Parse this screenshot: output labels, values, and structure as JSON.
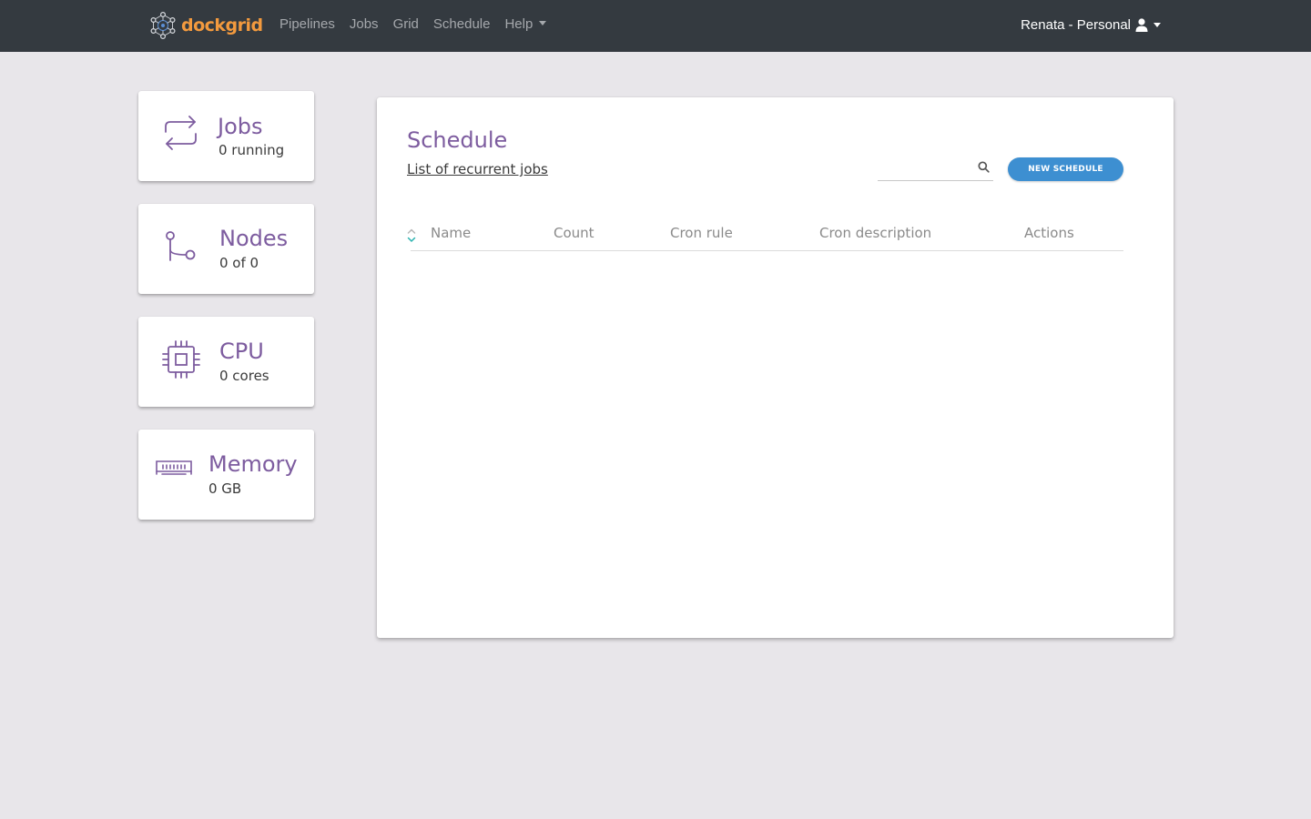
{
  "navbar": {
    "brand": "dockgrid",
    "links": [
      "Pipelines",
      "Jobs",
      "Grid",
      "Schedule"
    ],
    "help_label": "Help",
    "user_label": "Renata - Personal"
  },
  "stats": {
    "jobs": {
      "title": "Jobs",
      "subtitle": "0 running",
      "icon": "repeat-icon"
    },
    "nodes": {
      "title": "Nodes",
      "subtitle": "0 of 0",
      "icon": "branch-icon"
    },
    "cpu": {
      "title": "CPU",
      "subtitle": "0 cores",
      "icon": "cpu-chip-icon"
    },
    "memory": {
      "title": "Memory",
      "subtitle": "0 GB",
      "icon": "memory-module-icon"
    }
  },
  "schedule": {
    "title": "Schedule",
    "subtitle": "List of recurrent jobs",
    "search": {
      "value": "",
      "placeholder": ""
    },
    "new_button": "NEW SCHEDULE",
    "columns": [
      "Name",
      "Count",
      "Cron rule",
      "Cron description",
      "Actions"
    ],
    "rows": []
  },
  "colors": {
    "navbar_bg": "#343a40",
    "brand": "#f39a3e",
    "accent_purple": "#7d5c9f",
    "button_blue": "#3d8fd1",
    "sort_teal": "#2bb3b0",
    "page_bg": "#e8e6ea"
  }
}
